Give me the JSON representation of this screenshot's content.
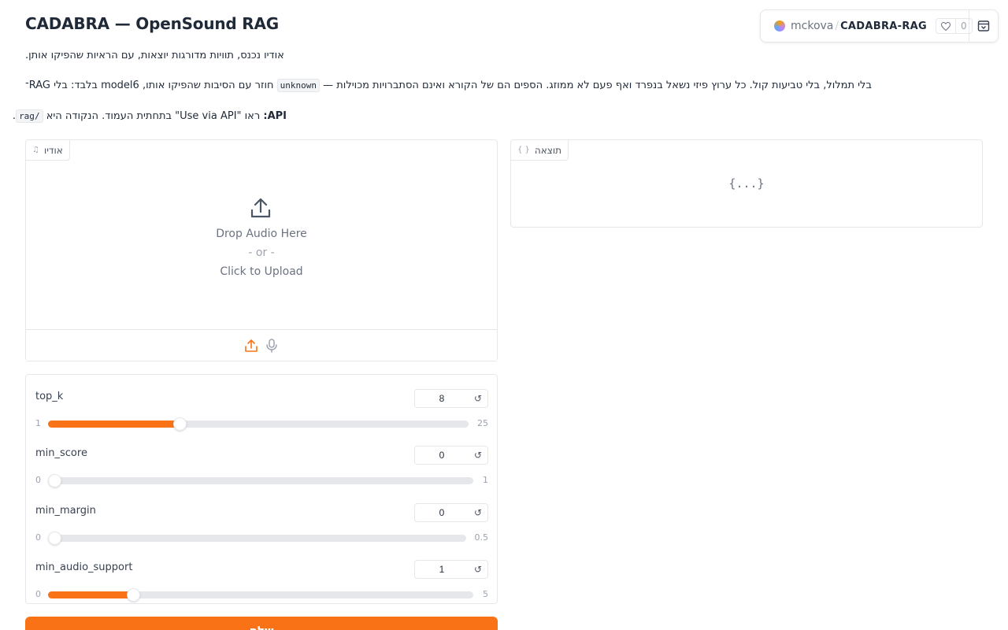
{
  "header": {
    "title": "CADABRA — OpenSound RAG",
    "line1": "אודיו נכנס, תוויות מדורגות יוצאות, עם הראיות שהפיקו אותן.",
    "line2_a": "בלי תמלול, בלי טביעות קול. כל ערוץ פיזי נשאל בנפרד ואף פעם לא ממוזג. הספים הם של הקורא ואינם הסתברויות מכוילות — ",
    "line2_code": "unknown",
    "line2_b": " חוזר עם הסיבות שהפיקו אותו, model6 בלבד: בלי RAG־",
    "line3_bold": "API:",
    "line3_a": " ראו \"Use via API\" בתחתית העמוד. הנקודה היא ",
    "line3_code": "/rag",
    "line3_b": "."
  },
  "hf_badge": {
    "user": "mckova",
    "slash": "/",
    "repo": "CADABRA-RAG",
    "likes": "0",
    "heart_icon": "heart-icon",
    "menu_icon": "collapse-icon"
  },
  "audio": {
    "label": "אודיו",
    "icon": "music-note-icon",
    "drop": "Drop Audio Here",
    "or": "- or -",
    "click": "Click to Upload"
  },
  "output": {
    "label": "תוצאה",
    "icon": "braces-icon",
    "placeholder": "{...}"
  },
  "sliders": [
    {
      "label": "top_k",
      "value": "8",
      "min": "1",
      "max": "25",
      "fraction": 0.3125,
      "reset": "↺"
    },
    {
      "label": "min_score",
      "value": "0",
      "min": "0",
      "max": "1",
      "fraction": 0,
      "reset": "↺"
    },
    {
      "label": "min_margin",
      "value": "0",
      "min": "0",
      "max": "0.5",
      "fraction": 0,
      "reset": "↺"
    },
    {
      "label": "min_audio_support",
      "value": "1",
      "min": "0",
      "max": "5",
      "fraction": 0.2,
      "reset": "↺"
    }
  ],
  "colors": {
    "accent": "#f97316"
  },
  "submit": {
    "label": "שלח"
  }
}
